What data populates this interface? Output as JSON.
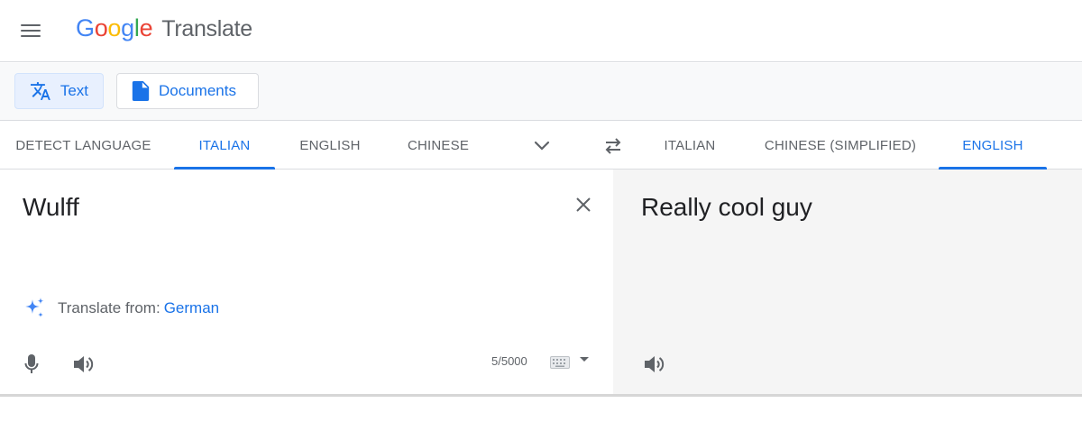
{
  "header": {
    "logo": [
      "G",
      "o",
      "o",
      "g",
      "l",
      "e"
    ],
    "product": "Translate",
    "menu_icon": "hamburger-menu-icon"
  },
  "modes": {
    "text_label": "Text",
    "documents_label": "Documents",
    "text_icon": "translate-icon",
    "documents_icon": "document-icon"
  },
  "source_languages": {
    "tabs": [
      "DETECT LANGUAGE",
      "ITALIAN",
      "ENGLISH",
      "CHINESE"
    ],
    "active": "ITALIAN"
  },
  "target_languages": {
    "tabs": [
      "ITALIAN",
      "CHINESE (SIMPLIFIED)",
      "ENGLISH"
    ],
    "active": "ENGLISH"
  },
  "source": {
    "text": "Wulff",
    "detect_prefix": "Translate from:",
    "detect_language": "German",
    "char_count": "5/5000"
  },
  "target": {
    "text": "Really cool guy"
  },
  "colors": {
    "accent": "#1a73e8",
    "active_mode_bg": "#e8f0fe",
    "target_panel_bg": "#f5f5f5"
  }
}
